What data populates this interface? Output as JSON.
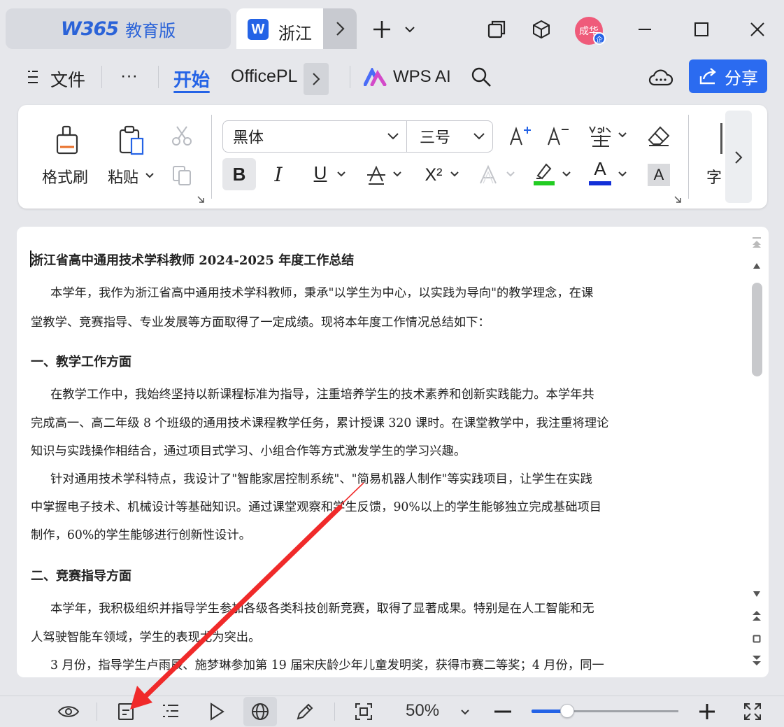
{
  "titlebar": {
    "app_logo": "W365",
    "app_edition": "教育版",
    "doc_tab_icon": "W",
    "doc_tab_title": "浙江",
    "avatar_text": "成华",
    "avatar_badge": "企"
  },
  "menu": {
    "file": "文件",
    "more": "···",
    "tab_home": "开始",
    "tab_officeplus": "OfficePL",
    "wps_ai": "WPS AI",
    "share": "分享"
  },
  "ribbon": {
    "format_painter": "格式刷",
    "paste": "粘贴",
    "font_name": "黑体",
    "font_size": "三号",
    "bold": "B",
    "italic": "I",
    "underline": "U",
    "superscript": "X²",
    "char_shading": "A",
    "font_color": "A",
    "more_label": "字",
    "highlight_color": "#22cc22",
    "font_color_value": "#1330d8"
  },
  "document": {
    "title": "浙江省高中通用技术学科教师 2024-2025 年度工作总结",
    "lines": [
      "本学年，我作为浙江省高中通用技术学科教师，秉承\"以学生为中心，以实践为导向\"的教学理念，在课",
      "堂教学、竞赛指导、专业发展等方面取得了一定成绩。现将本年度工作情况总结如下：",
      "一、教学工作方面",
      "在教学工作中，我始终坚持以新课程标准为指导，注重培养学生的技术素养和创新实践能力。本学年共",
      "完成高一、高二年级 8 个班级的通用技术课程教学任务，累计授课 320 课时。在课堂教学中，我注重将理论",
      "知识与实践操作相结合，通过项目式学习、小组合作等方式激发学生的学习兴趣。",
      "针对通用技术学科特点，我设计了\"智能家居控制系统\"、\"简易机器人制作\"等实践项目，让学生在实践",
      "中掌握电子技术、机械设计等基础知识。通过课堂观察和学生反馈，90%以上的学生能够独立完成基础项目",
      "制作，60%的学生能够进行创新性设计。",
      "二、竞赛指导方面",
      "本学年，我积极组织并指导学生参加各级各类科技创新竞赛，取得了显著成果。特别是在人工智能和无",
      "人驾驶智能车领域，学生的表现尤为突出。",
      "3 月份，指导学生卢雨辰、施梦琳参加第 19 届宋庆龄少年儿童发明奖，获得市赛二等奖；4 月份，同一"
    ]
  },
  "statusbar": {
    "zoom_label": "50%",
    "zoom_value": 50
  }
}
